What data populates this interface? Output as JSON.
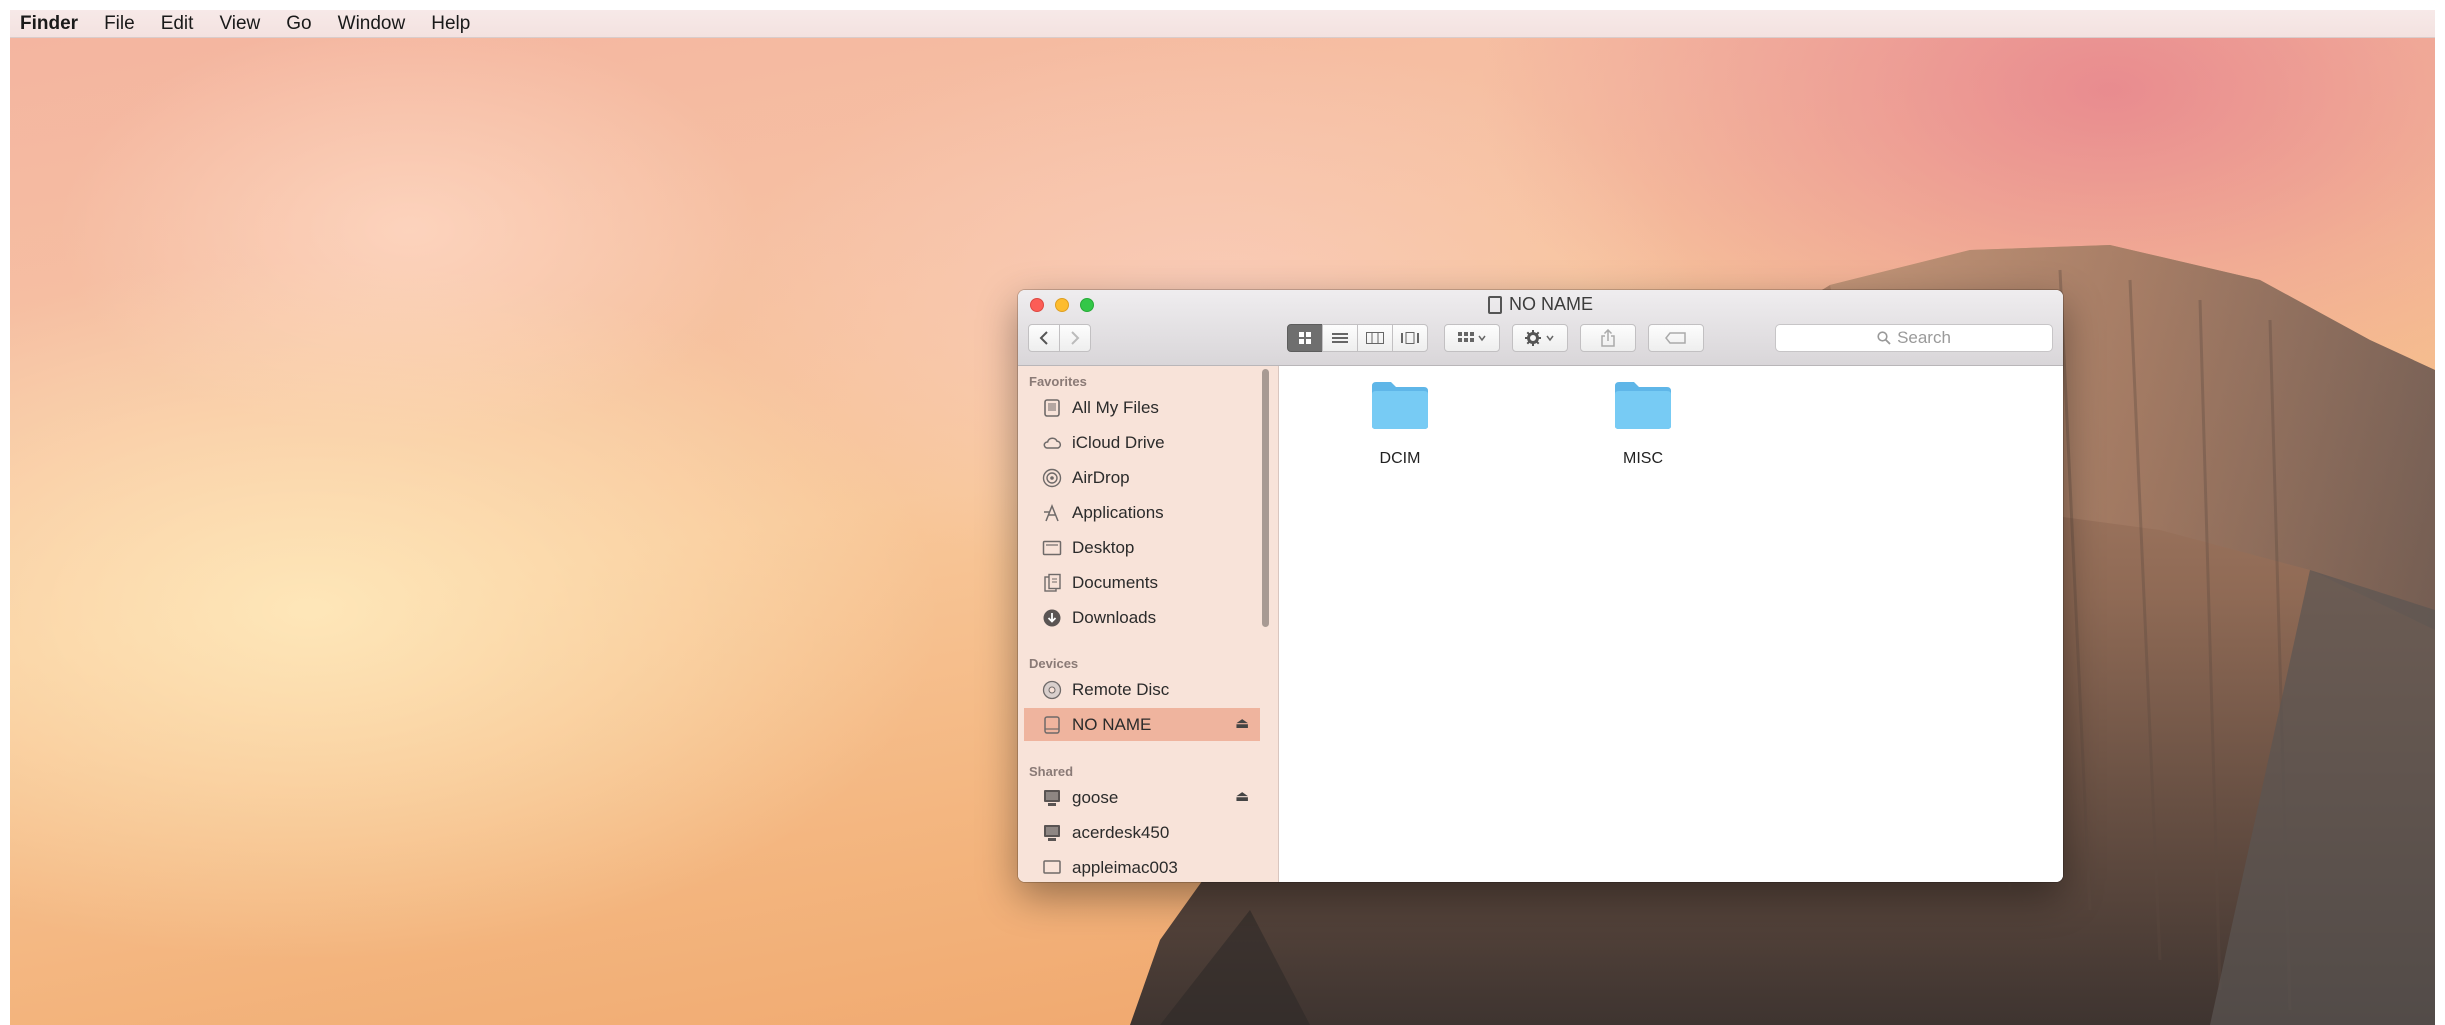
{
  "menubar": {
    "app_name": "Finder",
    "items": [
      "File",
      "Edit",
      "View",
      "Go",
      "Window",
      "Help"
    ]
  },
  "window": {
    "title": "NO NAME",
    "search_placeholder": "Search",
    "view_mode": "icon"
  },
  "sidebar": {
    "favorites_label": "Favorites",
    "favorites": [
      {
        "label": "All My Files",
        "icon": "all-files-icon"
      },
      {
        "label": "iCloud Drive",
        "icon": "cloud-icon"
      },
      {
        "label": "AirDrop",
        "icon": "airdrop-icon"
      },
      {
        "label": "Applications",
        "icon": "applications-icon"
      },
      {
        "label": "Desktop",
        "icon": "desktop-icon"
      },
      {
        "label": "Documents",
        "icon": "documents-icon"
      },
      {
        "label": "Downloads",
        "icon": "downloads-icon"
      }
    ],
    "devices_label": "Devices",
    "devices": [
      {
        "label": "Remote Disc",
        "icon": "disc-icon"
      },
      {
        "label": "NO NAME",
        "icon": "drive-icon",
        "selected": true,
        "eject": "⏏"
      }
    ],
    "shared_label": "Shared",
    "shared": [
      {
        "label": "goose",
        "icon": "computer-icon",
        "eject": "⏏"
      },
      {
        "label": "acerdesk450",
        "icon": "computer-icon"
      },
      {
        "label": "appleimac003",
        "icon": "monitor-icon"
      }
    ]
  },
  "content": {
    "items": [
      {
        "name": "DCIM",
        "icon": "folder-icon"
      },
      {
        "name": "MISC",
        "icon": "folder-icon"
      }
    ]
  },
  "colors": {
    "folder": "#6cc3f0",
    "selection": "#efb49e",
    "close": "#fc5d56",
    "minimize": "#fdbc2e",
    "zoom": "#33c748"
  }
}
